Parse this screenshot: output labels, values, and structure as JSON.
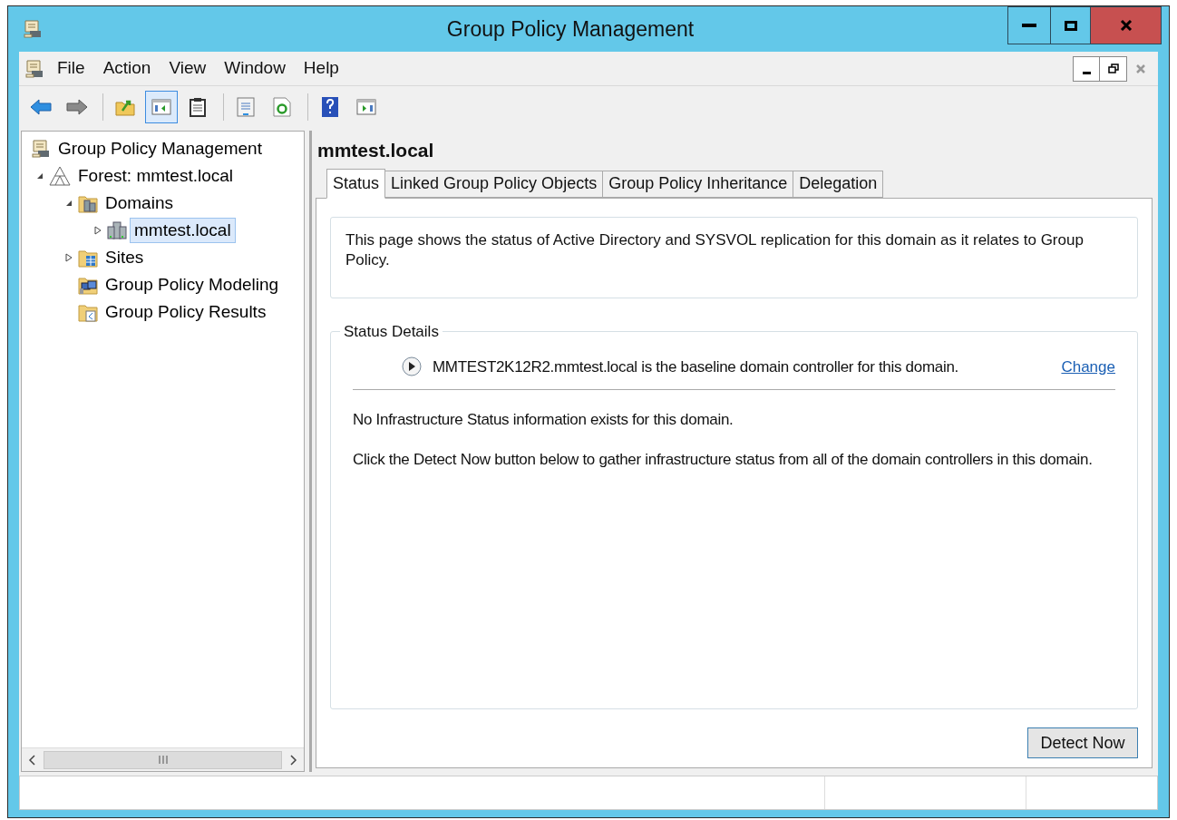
{
  "window": {
    "title": "Group Policy Management"
  },
  "menu": [
    "File",
    "Action",
    "View",
    "Window",
    "Help"
  ],
  "toolbar": [
    {
      "kind": "back",
      "pressed": false
    },
    {
      "kind": "forward",
      "pressed": false
    },
    {
      "kind": "up",
      "pressed": false
    },
    {
      "kind": "tree",
      "pressed": true
    },
    {
      "kind": "clipboard",
      "pressed": false
    },
    {
      "kind": "properties",
      "pressed": false
    },
    {
      "kind": "refresh",
      "pressed": false
    },
    {
      "kind": "help",
      "pressed": false
    },
    {
      "kind": "pane",
      "pressed": false
    }
  ],
  "tree": [
    {
      "label": "Group Policy Management",
      "kind": "console",
      "selected": false,
      "children": [
        {
          "label": "Forest: mmtest.local",
          "kind": "forest",
          "expanded": true,
          "selected": false,
          "children": [
            {
              "label": "Domains",
              "kind": "folder-servers",
              "expanded": true,
              "selected": false,
              "children": [
                {
                  "label": "mmtest.local",
                  "kind": "servers",
                  "expanded": false,
                  "selected": true
                }
              ]
            },
            {
              "label": "Sites",
              "kind": "folder-sites",
              "expanded": false,
              "selected": false
            },
            {
              "label": "Group Policy Modeling",
              "kind": "modeling",
              "selected": false
            },
            {
              "label": "Group Policy Results",
              "kind": "folder-results",
              "selected": false
            }
          ]
        }
      ]
    }
  ],
  "content": {
    "heading": "mmtest.local",
    "tabs": [
      {
        "label": "Status",
        "selected": true
      },
      {
        "label": "Linked Group Policy Objects",
        "selected": false
      },
      {
        "label": "Group Policy Inheritance",
        "selected": false
      },
      {
        "label": "Delegation",
        "selected": false
      }
    ],
    "intro": "This page shows the status of Active Directory and SYSVOL replication for this domain as it relates to Group Policy.",
    "group_title": "Status Details",
    "baseline": "MMTEST2K12R2.mmtest.local is the baseline domain controller for this domain.",
    "change_link": "Change",
    "notes": [
      "No Infrastructure Status information exists for this domain.",
      "Click the Detect Now button below to gather infrastructure status from all of the domain controllers in this domain."
    ],
    "button": "Detect Now"
  }
}
